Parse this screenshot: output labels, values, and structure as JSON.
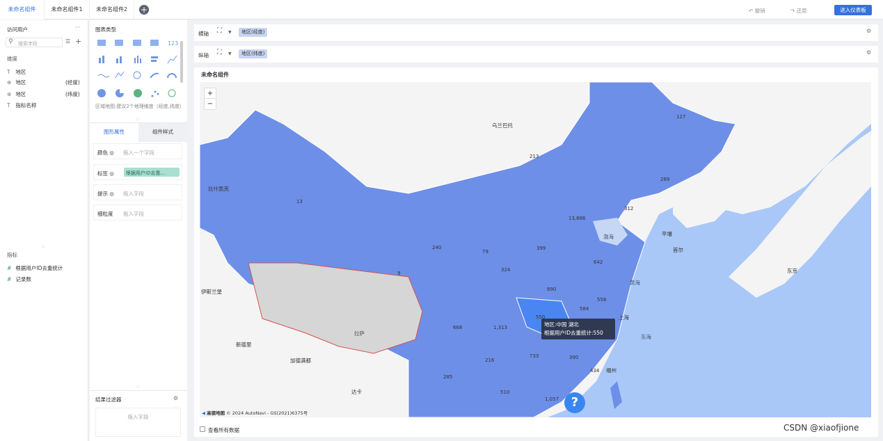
{
  "tabs": [
    "未命名组件",
    "未命名组件1",
    "未命名组件2"
  ],
  "toolbar": {
    "undo": "撤销",
    "redo": "还原",
    "enter": "进入仪表板"
  },
  "left": {
    "dataset": "访问用户",
    "search_placeholder": "搜索字段",
    "dim_title": "维度",
    "dims": [
      {
        "icon": "T",
        "name": "地区",
        "suffix": ""
      },
      {
        "icon": "globe",
        "name": "地区",
        "suffix": "(经度)"
      },
      {
        "icon": "globe",
        "name": "地区",
        "suffix": "(纬度)"
      },
      {
        "icon": "T",
        "name": "指标名称",
        "suffix": ""
      }
    ],
    "metric_title": "指标",
    "metrics": [
      "根据用户ID去重统计",
      "记录数"
    ]
  },
  "middle": {
    "chart_type_title": "图表类型",
    "hint": "区域地图:建议2个地理维度（经度,纬度）",
    "tabs": [
      "图形属性",
      "组件样式"
    ],
    "attrs": [
      {
        "label": "颜色",
        "value": "拖入一个字段",
        "filled": false
      },
      {
        "label": "标签",
        "value": "根据用户ID去重...",
        "filled": true
      },
      {
        "label": "提示",
        "value": "拖入字段",
        "filled": false
      },
      {
        "label": "细粒度",
        "value": "拖入字段",
        "filled": false
      }
    ],
    "filter_title": "结果过滤器",
    "filter_placeholder": "拖入字段"
  },
  "axes": {
    "x_label": "横轴",
    "x_field": "地区(经度)",
    "y_label": "纵轴",
    "y_field": "地区(纬度)"
  },
  "widget": {
    "title": "未命名组件",
    "show_all": "查看所有数据"
  },
  "map": {
    "zoom_in": "+",
    "zoom_out": "−",
    "places": [
      "乌兰巴托",
      "比什凯克",
      "伊斯兰堡",
      "新德里",
      "加德满都",
      "拉萨",
      "达卡",
      "平壤",
      "首尔",
      "东京",
      "渤海",
      "黄海",
      "东海",
      "福州",
      "上海"
    ],
    "values": [
      "127",
      "213",
      "289",
      "312",
      "13",
      "13,686",
      "240",
      "79",
      "399",
      "642",
      "324",
      "9",
      "890",
      "584",
      "558",
      "550",
      "668",
      "1,313",
      "733",
      "390",
      "216",
      "434",
      "285",
      "510",
      "1,057"
    ],
    "tooltip": {
      "line1": "地区:中国 湖北",
      "line2": "根据用户ID去重统计:550"
    },
    "attribution": "© 2024 AutoNavi - GS(2021)6375号",
    "brand": "高德地图",
    "help": "?"
  },
  "watermark": "CSDN @xiaofjione",
  "colors": {
    "accent": "#3670e0",
    "province": "#6d8fe8",
    "hubei": "#4a86f2",
    "ocean": "#a9c8f8",
    "land": "#f4f4f4",
    "tibet": "#d6d6d6"
  }
}
